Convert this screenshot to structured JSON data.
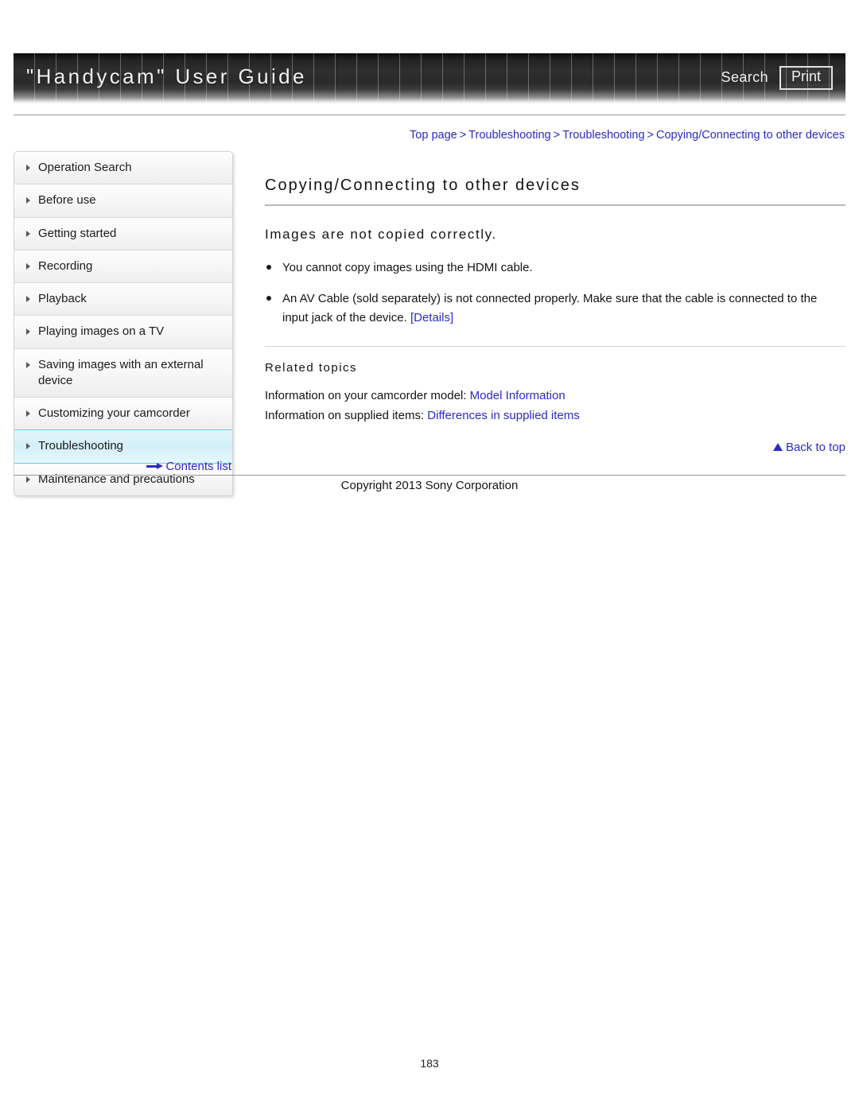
{
  "header": {
    "title": "\"Handycam\" User Guide",
    "search_label": "Search",
    "print_label": "Print"
  },
  "breadcrumb": {
    "separator": ">",
    "items": [
      {
        "label": "Top page"
      },
      {
        "label": "Troubleshooting"
      },
      {
        "label": "Troubleshooting"
      },
      {
        "label": "Copying/Connecting to other devices"
      }
    ]
  },
  "sidebar": {
    "items": [
      {
        "label": "Operation Search",
        "active": false
      },
      {
        "label": "Before use",
        "active": false
      },
      {
        "label": "Getting started",
        "active": false
      },
      {
        "label": "Recording",
        "active": false
      },
      {
        "label": "Playback",
        "active": false
      },
      {
        "label": "Playing images on a TV",
        "active": false
      },
      {
        "label": "Saving images with an external device",
        "active": false
      },
      {
        "label": "Customizing your camcorder",
        "active": false
      },
      {
        "label": "Troubleshooting",
        "active": true
      },
      {
        "label": "Maintenance and precautions",
        "active": false
      }
    ],
    "contents_list_label": "Contents list"
  },
  "main": {
    "page_title": "Copying/Connecting to other devices",
    "section_heading": "Images are not copied correctly.",
    "bullets": [
      {
        "text": "You cannot copy images using the HDMI cable.",
        "link": ""
      },
      {
        "text": "An AV Cable (sold separately) is not connected properly. Make sure that the cable is connected to the input jack of the device. ",
        "link": "[Details]"
      }
    ],
    "related": {
      "heading": "Related topics",
      "lines": [
        {
          "text": "Information on your camcorder model: ",
          "link": "Model Information"
        },
        {
          "text": "Information on supplied items: ",
          "link": "Differences in supplied items"
        }
      ]
    },
    "back_to_top_label": "Back to top"
  },
  "footer": {
    "copyright": "Copyright 2013 Sony Corporation",
    "page_number": "183"
  },
  "colors": {
    "link": "#2b2bc6",
    "active_nav_bg": "#d3eff8",
    "active_nav_border": "#62cbe2"
  }
}
